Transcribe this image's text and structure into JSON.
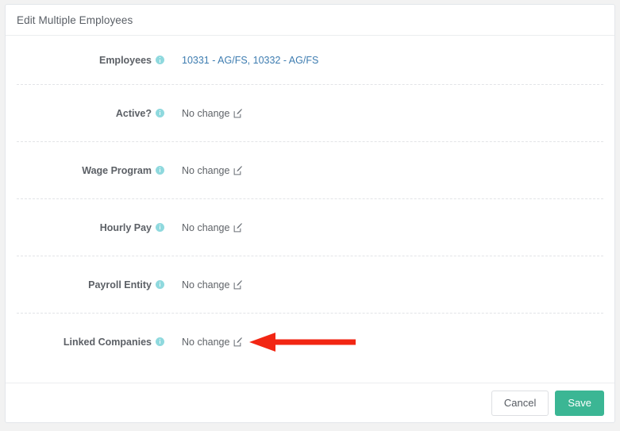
{
  "window": {
    "title": "Edit Multiple Employees",
    "background_color": "#f2f2f2",
    "card_background": "#ffffff"
  },
  "colors": {
    "link": "#3d7cb0",
    "info_icon": "#8fd9de",
    "save_button": "#3bb694",
    "annotation_arrow": "#f22613",
    "label_text": "#5c6066",
    "value_text": "#5f6368"
  },
  "form": {
    "rows": [
      {
        "label": "Employees",
        "info_icon": "info-icon",
        "value": "10331 - AG/FS, 10332 - AG/FS",
        "is_link": true,
        "has_edit_icon": false
      },
      {
        "label": "Active?",
        "info_icon": "info-icon",
        "value": "No change",
        "is_link": false,
        "has_edit_icon": true
      },
      {
        "label": "Wage Program",
        "info_icon": "info-icon",
        "value": "No change",
        "is_link": false,
        "has_edit_icon": true
      },
      {
        "label": "Hourly Pay",
        "info_icon": "info-icon",
        "value": "No change",
        "is_link": false,
        "has_edit_icon": true
      },
      {
        "label": "Payroll Entity",
        "info_icon": "info-icon",
        "value": "No change",
        "is_link": false,
        "has_edit_icon": true
      },
      {
        "label": "Linked Companies",
        "info_icon": "info-icon",
        "value": "No change",
        "is_link": false,
        "has_edit_icon": true
      }
    ]
  },
  "footer": {
    "cancel_label": "Cancel",
    "save_label": "Save"
  },
  "annotation": {
    "type": "left-arrow",
    "color": "#f22613",
    "points_at": "Linked Companies"
  }
}
